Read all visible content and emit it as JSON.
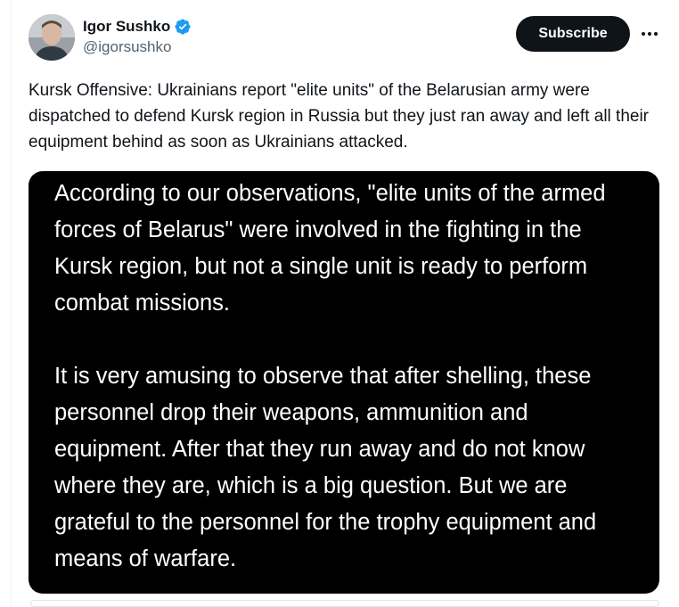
{
  "author": {
    "display_name": "Igor Sushko",
    "handle": "@igorsushko",
    "verified": true
  },
  "actions": {
    "subscribe_label": "Subscribe",
    "more_icon": "more-horizontal-icon"
  },
  "tweet": {
    "text": "Kursk Offensive: Ukrainians report \"elite units\" of the Belarusian army were dispatched to defend Kursk region in Russia but they just ran away and left all their equipment behind as soon as Ukrainians attacked."
  },
  "media": {
    "paragraph_1": "According to our observations, \"elite units of the armed forces of Belarus\" were involved in the fighting in the Kursk region, but not a single unit is ready to perform combat missions.",
    "paragraph_2": "It is very amusing to observe that after shelling, these personnel drop their weapons, ammunition and equipment. After that they run away and do not know where they are, which is a big question. But we are grateful to the personnel for the trophy equipment and means of warfare."
  },
  "colors": {
    "verified": "#1d9bf0",
    "subscribe_bg": "#0f1419",
    "media_bg": "#000000",
    "handle": "#536471"
  }
}
